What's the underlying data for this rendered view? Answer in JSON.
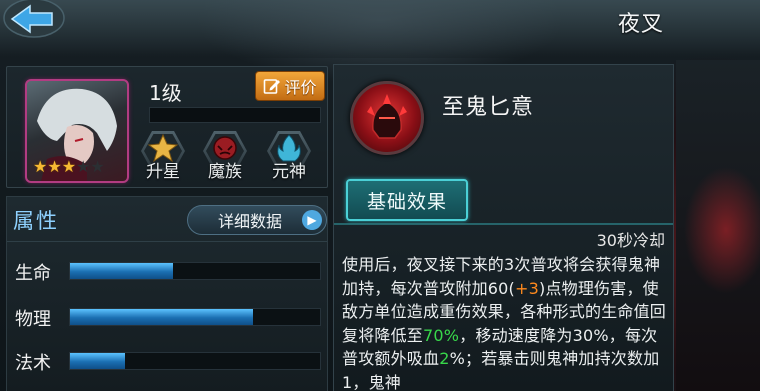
{
  "header": {
    "title": "夜叉"
  },
  "hero": {
    "level_text": "1级",
    "rate_button_label": "评价",
    "stars": {
      "filled": 3,
      "total": 5
    },
    "features": [
      {
        "label": "升星",
        "icon": "star-icon"
      },
      {
        "label": "魔族",
        "icon": "demon-clan-icon"
      },
      {
        "label": "元神",
        "icon": "spirit-flame-icon"
      }
    ]
  },
  "attributes": {
    "title": "属性",
    "details_button_label": "详细数据",
    "stats": [
      {
        "name": "生命",
        "fill_fraction": 0.41
      },
      {
        "name": "物理",
        "fill_fraction": 0.73
      },
      {
        "name": "法术",
        "fill_fraction": 0.22
      }
    ]
  },
  "skill": {
    "name": "至鬼匕意",
    "tab_label": "基础效果",
    "cooldown": "30秒冷却",
    "description": {
      "p1": "使用后，夜叉接下来的3次普攻将会获得鬼神加持，每次普攻附加60(",
      "p1_bonus": "+3",
      "p2": ")点物理伤害，使敌方单位造成重伤效果，各种形式的生命值回复将降低至",
      "p2_percent": "70%",
      "p3": "，移动速度降为30%，每次普攻额外吸血",
      "p3_lifesteal": "2",
      "p4": "%；若暴击则鬼神加持次数加1，鬼神"
    }
  },
  "colors": {
    "accent_blue": "#8fd2ff",
    "rate_orange": "#e08a25",
    "tab_teal": "#4bd0d6",
    "bonus_orange": "#ff8a1e",
    "value_green": "#38d84a"
  }
}
